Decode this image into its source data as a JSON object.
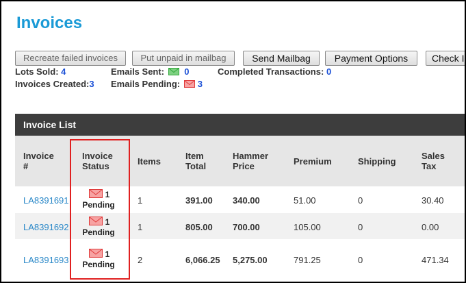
{
  "page": {
    "title": "Invoices"
  },
  "toolbar": {
    "recreate_failed": "Recreate failed invoices",
    "put_unpaid": "Put unpaid in mailbag",
    "send_mailbag": "Send Mailbag",
    "payment_options": "Payment Options",
    "check": "Check I"
  },
  "stats": {
    "lots_sold_label": "Lots Sold:",
    "lots_sold_value": "4",
    "emails_sent_label": "Emails Sent:",
    "emails_sent_value": "0",
    "completed_label": "Completed Transactions:",
    "completed_value": "0",
    "invoices_created_label": "Invoices Created:",
    "invoices_created_value": "3",
    "emails_pending_label": "Emails Pending:",
    "emails_pending_value": "3"
  },
  "invoice_list": {
    "heading": "Invoice List",
    "columns": {
      "invoice_1": "Invoice",
      "invoice_2": "#",
      "status_1": "Invoice",
      "status_2": "Status",
      "items": "Items",
      "item_total_1": "Item",
      "item_total_2": "Total",
      "hammer_1": "Hammer",
      "hammer_2": "Price",
      "premium": "Premium",
      "shipping": "Shipping",
      "tax_1": "Sales",
      "tax_2": "Tax"
    },
    "rows": [
      {
        "invoice": "LA8391691",
        "status_count": "1",
        "status_text": "Pending",
        "items": "1",
        "item_total": "391.00",
        "hammer": "340.00",
        "premium": "51.00",
        "shipping": "0",
        "tax": "30.40"
      },
      {
        "invoice": "LA8391692",
        "status_count": "1",
        "status_text": "Pending",
        "items": "1",
        "item_total": "805.00",
        "hammer": "700.00",
        "premium": "105.00",
        "shipping": "0",
        "tax": "0.00"
      },
      {
        "invoice": "LA8391693",
        "status_count": "1",
        "status_text": "Pending",
        "items": "2",
        "item_total": "6,066.25",
        "hammer": "5,275.00",
        "premium": "791.25",
        "shipping": "0",
        "tax": "471.34"
      }
    ]
  },
  "icons": {
    "sent_envelope": "envelope-green-icon",
    "pending_envelope": "envelope-red-icon"
  },
  "colors": {
    "title": "#1a9ad6",
    "link": "#2a88c8",
    "count": "#1a4fd6",
    "highlight": "#e02020",
    "envelope_sent": "#2fa83a",
    "envelope_pending": "#e03a3a"
  }
}
